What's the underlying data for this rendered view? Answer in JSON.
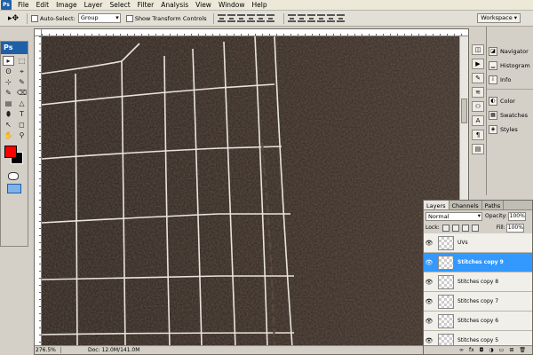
{
  "app": {
    "badge": "Ps"
  },
  "menu": [
    "File",
    "Edit",
    "Image",
    "Layer",
    "Select",
    "Filter",
    "Analysis",
    "View",
    "Window",
    "Help"
  ],
  "options": {
    "tool_icon": "move-tool-icon",
    "auto_select_label": "Auto-Select:",
    "auto_select_value": "Group",
    "show_transform_label": "Show Transform Controls",
    "workspace_label": "Workspace"
  },
  "toolbox": {
    "logo": "Ps",
    "tools": [
      "▸",
      "⬚",
      "ʘ",
      "⌖",
      "⊹",
      "✎",
      "✎",
      "⌫",
      "▤",
      "△",
      "⬮",
      "T",
      "↖",
      "◻",
      "✋",
      "⚲"
    ],
    "foreground_color": "#ff0000",
    "background_color": "#000000"
  },
  "document": {
    "zoom": "276.5%",
    "doc_size": "Doc: 12.0M/141.0M"
  },
  "panels": {
    "group1": [
      {
        "label": "Navigator",
        "icon": "navigator-icon"
      },
      {
        "label": "Histogram",
        "icon": "histogram-icon"
      },
      {
        "label": "Info",
        "icon": "info-icon"
      }
    ],
    "group2": [
      {
        "label": "Color",
        "icon": "color-icon"
      },
      {
        "label": "Swatches",
        "icon": "swatches-icon"
      },
      {
        "label": "Styles",
        "icon": "styles-icon"
      }
    ]
  },
  "layers_panel": {
    "tabs": [
      "Layers",
      "Channels",
      "Paths"
    ],
    "blend_mode": "Normal",
    "opacity_label": "Opacity:",
    "opacity_value": "100%",
    "lock_label": "Lock:",
    "fill_label": "Fill:",
    "fill_value": "100%",
    "layers": [
      {
        "name": "UVs",
        "selected": false
      },
      {
        "name": "Stitches copy 9",
        "selected": true
      },
      {
        "name": "Stitches copy 8",
        "selected": false
      },
      {
        "name": "Stitches copy 7",
        "selected": false
      },
      {
        "name": "Stitches copy 6",
        "selected": false
      },
      {
        "name": "Stitches copy 5",
        "selected": false
      }
    ],
    "footer_icons": [
      "link-icon",
      "fx-icon",
      "mask-icon",
      "adjustment-icon",
      "folder-icon",
      "new-layer-icon",
      "trash-icon"
    ]
  }
}
